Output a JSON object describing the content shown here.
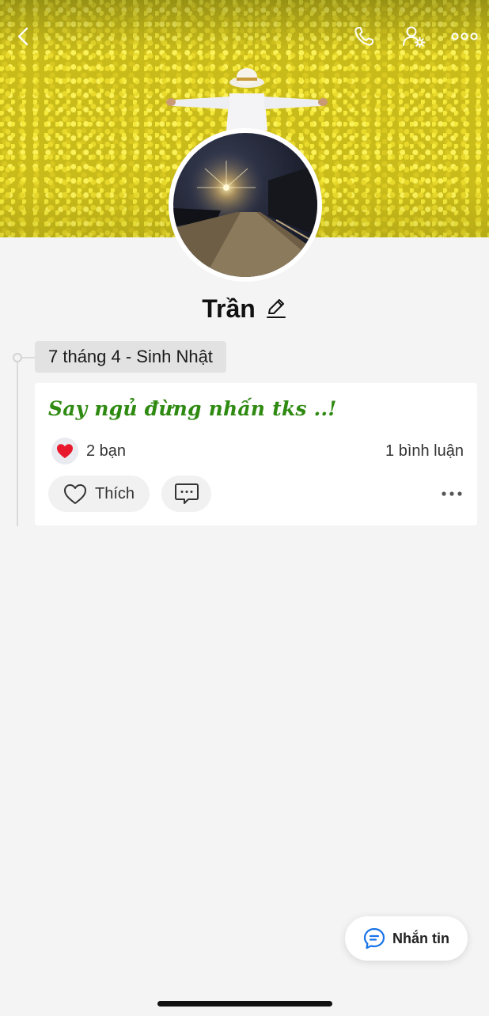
{
  "profile": {
    "name": "Trần"
  },
  "topbar": {
    "icons": [
      "back-icon",
      "phone-icon",
      "user-settings-icon",
      "more-icon"
    ]
  },
  "timeline": {
    "date_label": "7 tháng 4 - Sinh Nhật"
  },
  "post": {
    "text": "Say ngủ đừng nhấn tks ..!",
    "reaction_count": "2 bạn",
    "comment_count": "1 bình luận",
    "like_label": "Thích",
    "text_color": "#2f8a12"
  },
  "floating": {
    "message_label": "Nhắn tin",
    "accent": "#1a73e8"
  }
}
